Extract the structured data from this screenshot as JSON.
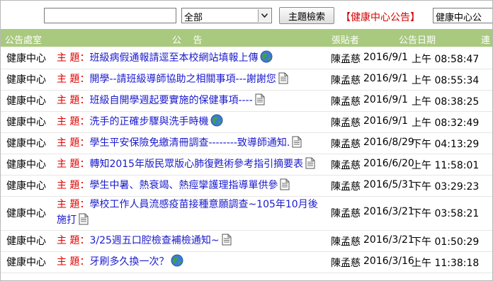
{
  "search": {
    "keyword_value": "",
    "category_selected": "全部",
    "search_button": "主題檢索",
    "bbs_title": "【健康中心公告】",
    "bbs_select_value": "健康中心公"
  },
  "table": {
    "headers": [
      "公告處室",
      "公    告",
      "張貼者",
      "公告日期",
      "連"
    ],
    "subject_prefix": "主 題：",
    "rows": [
      {
        "unit": "健康中心",
        "subject": "班級病假通報請逕至本校網站填報上傳",
        "icon": "globe-icon",
        "poster": "陳孟慈",
        "date": "2016/9/1",
        "time": "上午 08:58:47"
      },
      {
        "unit": "健康中心",
        "subject": "開學--請班級導師協助之相關事項---謝謝您",
        "icon": "document-icon",
        "poster": "陳孟慈",
        "date": "2016/9/1",
        "time": "上午 08:55:34"
      },
      {
        "unit": "健康中心",
        "subject": "班級自開學週起要實施的保健事項----",
        "icon": "document-icon",
        "poster": "陳孟慈",
        "date": "2016/9/1",
        "time": "上午 08:38:25"
      },
      {
        "unit": "健康中心",
        "subject": "洗手的正確步驟與洗手時機",
        "icon": "globe-icon",
        "poster": "陳孟慈",
        "date": "2016/9/1",
        "time": "上午 08:32:49"
      },
      {
        "unit": "健康中心",
        "subject": "學生平安保險免繳清冊調查--------致導師通知.",
        "icon": "document-icon",
        "poster": "陳孟慈",
        "date": "2016/8/29",
        "time": "下午 04:13:29"
      },
      {
        "unit": "健康中心",
        "subject": "轉知2015年版民眾版心肺復甦術參考指引摘要表",
        "icon": "document-icon",
        "poster": "陳孟慈",
        "date": "2016/6/20",
        "time": "上午 11:58:01"
      },
      {
        "unit": "健康中心",
        "subject": "學生中暑、熱衰竭、熱痙攣護理指導單供參",
        "icon": "document-icon",
        "poster": "陳孟慈",
        "date": "2016/5/31",
        "time": "下午 03:29:23"
      },
      {
        "unit": "健康中心",
        "subject": "學校工作人員流感疫苗接種意願調查~105年10月後施打",
        "icon": "document-icon",
        "poster": "陳孟慈",
        "date": "2016/3/21",
        "time": "下午 03:58:21"
      },
      {
        "unit": "健康中心",
        "subject": "3/25週五口腔檢查補檢通知~",
        "icon": "document-icon",
        "poster": "陳孟慈",
        "date": "2016/3/21",
        "time": "下午 01:50:29"
      },
      {
        "unit": "健康中心",
        "subject": "牙刷多久換一次？",
        "icon": "globe-icon",
        "poster": "陳孟慈",
        "date": "2016/3/16",
        "time": "上午 11:38:18"
      }
    ]
  }
}
